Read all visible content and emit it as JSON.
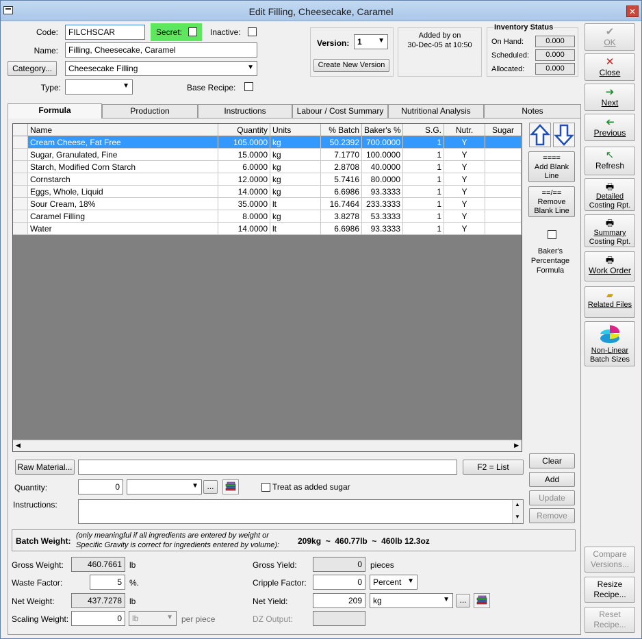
{
  "window": {
    "title": "Edit Filling, Cheesecake, Caramel"
  },
  "header": {
    "code_label": "Code:",
    "code_value": "FILCHSCAR",
    "secret_label": "Secret:",
    "inactive_label": "Inactive:",
    "name_label": "Name:",
    "name_value": "Filling, Cheesecake, Caramel",
    "category_button": "Category...",
    "category_value": "Cheesecake Filling",
    "type_label": "Type:",
    "type_value": "",
    "base_recipe_label": "Base Recipe:"
  },
  "version": {
    "label": "Version:",
    "value": "1",
    "create_button": "Create New Version",
    "added_by_line1": "Added by  on",
    "added_by_line2": "30-Dec-05 at 10:50"
  },
  "inventory": {
    "title": "Inventory Status",
    "on_hand_label": "On Hand:",
    "on_hand": "0.000",
    "scheduled_label": "Scheduled:",
    "scheduled": "0.000",
    "allocated_label": "Allocated:",
    "allocated": "0.000"
  },
  "tabs": [
    "Formula",
    "Production",
    "Instructions",
    "Labour / Cost Summary",
    "Nutritional Analysis",
    "Notes"
  ],
  "grid": {
    "headers": [
      "Name",
      "Quantity",
      "Units",
      "% Batch",
      "Baker's %",
      "S.G.",
      "Nutr.",
      "Sugar"
    ],
    "rows": [
      [
        "Cream Cheese, Fat Free",
        "105.0000",
        "kg",
        "50.2392",
        "700.0000",
        "1",
        "Y",
        ""
      ],
      [
        "Sugar, Granulated, Fine",
        "15.0000",
        "kg",
        "7.1770",
        "100.0000",
        "1",
        "Y",
        ""
      ],
      [
        "Starch, Modified Corn Starch",
        "6.0000",
        "kg",
        "2.8708",
        "40.0000",
        "1",
        "Y",
        ""
      ],
      [
        "Cornstarch",
        "12.0000",
        "kg",
        "5.7416",
        "80.0000",
        "1",
        "Y",
        ""
      ],
      [
        "Eggs, Whole, Liquid",
        "14.0000",
        "kg",
        "6.6986",
        "93.3333",
        "1",
        "Y",
        ""
      ],
      [
        "Sour Cream, 18%",
        "35.0000",
        "lt",
        "16.7464",
        "233.3333",
        "1",
        "Y",
        ""
      ],
      [
        "Caramel Filling",
        "8.0000",
        "kg",
        "3.8278",
        "53.3333",
        "1",
        "Y",
        ""
      ],
      [
        "Water",
        "14.0000",
        "lt",
        "6.6986",
        "93.3333",
        "1",
        "Y",
        ""
      ]
    ]
  },
  "grid_side": {
    "add_blank_sym": "====",
    "add_blank_line1": "Add Blank",
    "add_blank_line2": "Line",
    "remove_blank_sym": "==/==",
    "remove_blank_line1": "Remove",
    "remove_blank_line2": "Blank Line",
    "bakers_line1": "Baker's",
    "bakers_line2": "Percentage",
    "bakers_line3": "Formula"
  },
  "entry": {
    "raw_material_button": "Raw Material...",
    "raw_material_value": "",
    "f2_button": "F2 = List",
    "clear_button": "Clear",
    "add_button": "Add",
    "update_button": "Update",
    "remove_button": "Remove",
    "quantity_label": "Quantity:",
    "quantity_value": "0",
    "more_button": "...",
    "treat_sugar_label": "Treat as added sugar",
    "instructions_label": "Instructions:"
  },
  "batch": {
    "label": "Batch Weight:",
    "note_line1": "(only meaningful if all ingredients are entered by weight or",
    "note_line2": "Specific Gravity is correct for ingredients entered by volume):",
    "value": "209kg  ~  460.77lb  ~  460lb 12.3oz"
  },
  "bottom": {
    "gross_weight_label": "Gross Weight:",
    "gross_weight": "460.7661",
    "gross_weight_unit": "lb",
    "waste_factor_label": "Waste Factor:",
    "waste_factor": "5",
    "waste_factor_unit": "%.",
    "net_weight_label": "Net Weight:",
    "net_weight": "437.7278",
    "net_weight_unit": "lb",
    "scaling_weight_label": "Scaling Weight:",
    "scaling_weight": "0",
    "scaling_unit": "lb",
    "per_piece": "per piece",
    "gross_yield_label": "Gross Yield:",
    "gross_yield": "0",
    "gross_yield_unit": "pieces",
    "cripple_factor_label": "Cripple Factor:",
    "cripple_factor": "0",
    "cripple_unit": "Percent",
    "net_yield_label": "Net Yield:",
    "net_yield": "209",
    "net_yield_unit": "kg",
    "dz_output_label": "DZ Output:",
    "dz_output": ""
  },
  "sidebar": {
    "ok": "OK",
    "close": "Close",
    "next": "Next",
    "previous": "Previous",
    "refresh": "Refresh",
    "detailed_line1": "Detailed",
    "detailed_line2": "Costing Rpt.",
    "summary_line1": "Summary",
    "summary_line2": "Costing Rpt.",
    "work_order": "Work Order",
    "related_files": "Related Files",
    "nonlinear_line1": "Non-Linear",
    "nonlinear_line2": "Batch Sizes",
    "compare_line1": "Compare",
    "compare_line2": "Versions...",
    "resize_line1": "Resize",
    "resize_line2": "Recipe...",
    "reset_line1": "Reset",
    "reset_line2": "Recipe..."
  },
  "colors": {
    "selection": "#3399ff",
    "secret_bg": "#5ee65e",
    "grid_bg": "#808080",
    "close_red": "#c9483b"
  }
}
